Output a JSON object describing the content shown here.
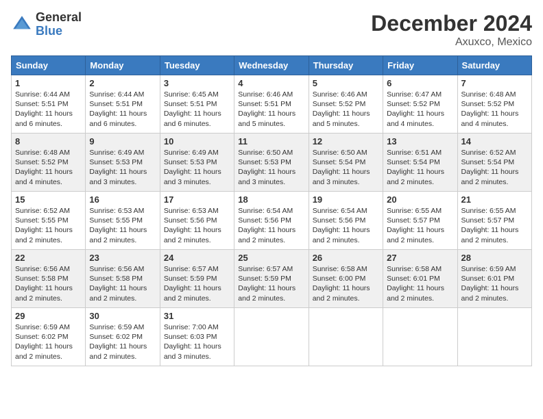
{
  "header": {
    "logo_general": "General",
    "logo_blue": "Blue",
    "month_title": "December 2024",
    "location": "Axuxco, Mexico"
  },
  "days_of_week": [
    "Sunday",
    "Monday",
    "Tuesday",
    "Wednesday",
    "Thursday",
    "Friday",
    "Saturday"
  ],
  "weeks": [
    [
      {
        "day": "1",
        "info": "Sunrise: 6:44 AM\nSunset: 5:51 PM\nDaylight: 11 hours and 6 minutes."
      },
      {
        "day": "2",
        "info": "Sunrise: 6:44 AM\nSunset: 5:51 PM\nDaylight: 11 hours and 6 minutes."
      },
      {
        "day": "3",
        "info": "Sunrise: 6:45 AM\nSunset: 5:51 PM\nDaylight: 11 hours and 6 minutes."
      },
      {
        "day": "4",
        "info": "Sunrise: 6:46 AM\nSunset: 5:51 PM\nDaylight: 11 hours and 5 minutes."
      },
      {
        "day": "5",
        "info": "Sunrise: 6:46 AM\nSunset: 5:52 PM\nDaylight: 11 hours and 5 minutes."
      },
      {
        "day": "6",
        "info": "Sunrise: 6:47 AM\nSunset: 5:52 PM\nDaylight: 11 hours and 4 minutes."
      },
      {
        "day": "7",
        "info": "Sunrise: 6:48 AM\nSunset: 5:52 PM\nDaylight: 11 hours and 4 minutes."
      }
    ],
    [
      {
        "day": "8",
        "info": "Sunrise: 6:48 AM\nSunset: 5:52 PM\nDaylight: 11 hours and 4 minutes."
      },
      {
        "day": "9",
        "info": "Sunrise: 6:49 AM\nSunset: 5:53 PM\nDaylight: 11 hours and 3 minutes."
      },
      {
        "day": "10",
        "info": "Sunrise: 6:49 AM\nSunset: 5:53 PM\nDaylight: 11 hours and 3 minutes."
      },
      {
        "day": "11",
        "info": "Sunrise: 6:50 AM\nSunset: 5:53 PM\nDaylight: 11 hours and 3 minutes."
      },
      {
        "day": "12",
        "info": "Sunrise: 6:50 AM\nSunset: 5:54 PM\nDaylight: 11 hours and 3 minutes."
      },
      {
        "day": "13",
        "info": "Sunrise: 6:51 AM\nSunset: 5:54 PM\nDaylight: 11 hours and 2 minutes."
      },
      {
        "day": "14",
        "info": "Sunrise: 6:52 AM\nSunset: 5:54 PM\nDaylight: 11 hours and 2 minutes."
      }
    ],
    [
      {
        "day": "15",
        "info": "Sunrise: 6:52 AM\nSunset: 5:55 PM\nDaylight: 11 hours and 2 minutes."
      },
      {
        "day": "16",
        "info": "Sunrise: 6:53 AM\nSunset: 5:55 PM\nDaylight: 11 hours and 2 minutes."
      },
      {
        "day": "17",
        "info": "Sunrise: 6:53 AM\nSunset: 5:56 PM\nDaylight: 11 hours and 2 minutes."
      },
      {
        "day": "18",
        "info": "Sunrise: 6:54 AM\nSunset: 5:56 PM\nDaylight: 11 hours and 2 minutes."
      },
      {
        "day": "19",
        "info": "Sunrise: 6:54 AM\nSunset: 5:56 PM\nDaylight: 11 hours and 2 minutes."
      },
      {
        "day": "20",
        "info": "Sunrise: 6:55 AM\nSunset: 5:57 PM\nDaylight: 11 hours and 2 minutes."
      },
      {
        "day": "21",
        "info": "Sunrise: 6:55 AM\nSunset: 5:57 PM\nDaylight: 11 hours and 2 minutes."
      }
    ],
    [
      {
        "day": "22",
        "info": "Sunrise: 6:56 AM\nSunset: 5:58 PM\nDaylight: 11 hours and 2 minutes."
      },
      {
        "day": "23",
        "info": "Sunrise: 6:56 AM\nSunset: 5:58 PM\nDaylight: 11 hours and 2 minutes."
      },
      {
        "day": "24",
        "info": "Sunrise: 6:57 AM\nSunset: 5:59 PM\nDaylight: 11 hours and 2 minutes."
      },
      {
        "day": "25",
        "info": "Sunrise: 6:57 AM\nSunset: 5:59 PM\nDaylight: 11 hours and 2 minutes."
      },
      {
        "day": "26",
        "info": "Sunrise: 6:58 AM\nSunset: 6:00 PM\nDaylight: 11 hours and 2 minutes."
      },
      {
        "day": "27",
        "info": "Sunrise: 6:58 AM\nSunset: 6:01 PM\nDaylight: 11 hours and 2 minutes."
      },
      {
        "day": "28",
        "info": "Sunrise: 6:59 AM\nSunset: 6:01 PM\nDaylight: 11 hours and 2 minutes."
      }
    ],
    [
      {
        "day": "29",
        "info": "Sunrise: 6:59 AM\nSunset: 6:02 PM\nDaylight: 11 hours and 2 minutes."
      },
      {
        "day": "30",
        "info": "Sunrise: 6:59 AM\nSunset: 6:02 PM\nDaylight: 11 hours and 2 minutes."
      },
      {
        "day": "31",
        "info": "Sunrise: 7:00 AM\nSunset: 6:03 PM\nDaylight: 11 hours and 3 minutes."
      },
      {
        "day": "",
        "info": ""
      },
      {
        "day": "",
        "info": ""
      },
      {
        "day": "",
        "info": ""
      },
      {
        "day": "",
        "info": ""
      }
    ]
  ]
}
